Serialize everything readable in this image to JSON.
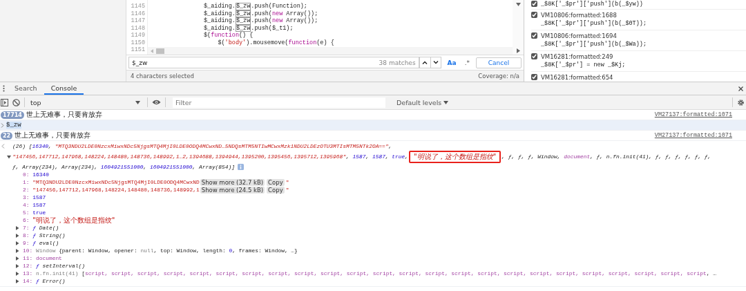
{
  "editor": {
    "line_numbers": [
      "1145",
      "1146",
      "1147",
      "1148",
      "1149",
      "1150",
      "1151"
    ],
    "lines": [
      [
        {
          "text": "$_aiding.",
          "kind": "plain"
        },
        {
          "text": "$_zw",
          "kind": "match"
        },
        {
          "text": ".push(Function);",
          "kind": "plain"
        }
      ],
      [
        {
          "text": "$_aiding.",
          "kind": "plain"
        },
        {
          "text": "$_zw",
          "kind": "match"
        },
        {
          "text": ".push(",
          "kind": "plain"
        },
        {
          "text": "new",
          "kind": "keyword"
        },
        {
          "text": " Array());",
          "kind": "plain"
        }
      ],
      [
        {
          "text": "$_aiding.",
          "kind": "plain"
        },
        {
          "text": "$_zw",
          "kind": "match"
        },
        {
          "text": ".push(",
          "kind": "plain"
        },
        {
          "text": "new",
          "kind": "keyword"
        },
        {
          "text": " Array());",
          "kind": "plain"
        }
      ],
      [
        {
          "text": "$_aiding.",
          "kind": "plain"
        },
        {
          "text": "$_zw",
          "kind": "match"
        },
        {
          "text": ".push($_t1);",
          "kind": "plain"
        }
      ],
      [
        {
          "text": "$(",
          "kind": "plain"
        },
        {
          "text": "function",
          "kind": "keyword"
        },
        {
          "text": "() {",
          "kind": "plain"
        }
      ],
      [
        {
          "text": "    $(",
          "kind": "plain"
        },
        {
          "text": "'body'",
          "kind": "string"
        },
        {
          "text": ").mousemove(",
          "kind": "plain"
        },
        {
          "text": "function",
          "kind": "keyword"
        },
        {
          "text": "(e) {",
          "kind": "plain"
        }
      ]
    ],
    "search": {
      "value": "$_zw",
      "matches": "38 matches",
      "case_label": "Aa",
      "regex_label": ".*",
      "cancel": "Cancel"
    },
    "status": {
      "selection": "4 characters selected",
      "coverage": "Coverage: n/a"
    }
  },
  "breakpoints": [
    {
      "code": "_$8K['_$pr']['push'](b(_$yw))",
      "checked": true
    },
    {
      "label": "VM10806:formatted:1688",
      "code": "_$8K['_$pr']['push'](b(_$0T));",
      "checked": true
    },
    {
      "label": "VM10806:formatted:1694",
      "code": "_$8K['_$pr']['push'](b(_$Wa));",
      "checked": true
    },
    {
      "label": "VM16281:formatted:249",
      "code": "_$8K['_$pr'] = new _$Kj;",
      "checked": true
    },
    {
      "label": "VM16281:formatted:654",
      "checked": true
    }
  ],
  "console": {
    "tabs": [
      {
        "label": "Search",
        "selected": false
      },
      {
        "label": "Console",
        "selected": true
      }
    ],
    "toolbar": {
      "context": "top",
      "filter_placeholder": "Filter",
      "levels": "Default levels"
    },
    "messages": [
      {
        "kind": "log",
        "count": "17714",
        "text": "世上无难事，只要肯放弃",
        "source": "VM27137:formatted:1071"
      },
      {
        "kind": "input",
        "text": "$_zw"
      },
      {
        "kind": "log",
        "count": "22",
        "text": "世上无难事，只要肯放弃",
        "source": "VM27137:formatted:1071"
      },
      {
        "kind": "result",
        "expanded": true,
        "summary": [
          [
            {
              "text": "(26) [",
              "kind": "plain"
            },
            {
              "text": "16340",
              "kind": "num"
            },
            {
              "text": ", ",
              "kind": "plain"
            },
            {
              "text": "\"MTQ3NDU2LDE0NzcxMiwxNDc5NjgsMTQ4MjI0LDE0ODQ4MCwxND…5NDQsMTM5NTIwMCwxMzk1NDU2LDEzOTU3MTIsMTM5NTk2OA==\"",
              "kind": "str"
            },
            {
              "text": ",",
              "kind": "plain"
            }
          ],
          [
            {
              "text": "\"147456,147712,147968,148224,148480,148736,148992,1…2,1394688,1394944,1395200,1395456,1395712,1395968\"",
              "kind": "str"
            },
            {
              "text": ", ",
              "kind": "plain"
            },
            {
              "text": "1587",
              "kind": "num"
            },
            {
              "text": ", ",
              "kind": "plain"
            },
            {
              "text": "1587",
              "kind": "num"
            },
            {
              "text": ", ",
              "kind": "plain"
            },
            {
              "text": "true",
              "kind": "num"
            },
            {
              "text": ",",
              "kind": "plain"
            },
            {
              "text": "\"明说了，这个数组是指纹\"",
              "kind": "cjk-str",
              "boxed": true
            },
            {
              "text": ", ƒ, ƒ, ƒ, Window, ",
              "kind": "plain"
            },
            {
              "text": "document",
              "kind": "obj"
            },
            {
              "text": ", ƒ, n.fn.init(41), ƒ, ƒ, ƒ, ƒ, ƒ, ƒ,",
              "kind": "plain"
            }
          ],
          [
            {
              "text": "ƒ, Array(234), Array(234), ",
              "kind": "plain"
            },
            {
              "text": "1604921551000",
              "kind": "num"
            },
            {
              "text": ", ",
              "kind": "plain"
            },
            {
              "text": "1604921551000",
              "kind": "num"
            },
            {
              "text": ", Array(854)]",
              "kind": "plain"
            }
          ]
        ],
        "entries": [
          {
            "key": "0:",
            "expandable": false,
            "value": [
              {
                "text": "16340",
                "kind": "num"
              }
            ]
          },
          {
            "key": "1:",
            "expandable": false,
            "value": [
              {
                "text": "\"MTQ3NDU2LDE0NzcxMiwxNDc5NjgsMTQ4MjI0LDE0ODQ4MCwxND",
                "kind": "str"
              },
              {
                "text": "Show more (32.7 kB)",
                "kind": "show_more"
              },
              {
                "text": "Copy",
                "kind": "copy"
              },
              {
                "text": "\"",
                "kind": "str"
              }
            ]
          },
          {
            "key": "2:",
            "expandable": false,
            "value": [
              {
                "text": "\"147456,147712,147968,148224,148480,148736,148992,1",
                "kind": "str"
              },
              {
                "text": "Show more (24.5 kB)",
                "kind": "show_more"
              },
              {
                "text": "Copy",
                "kind": "copy"
              },
              {
                "text": "\"",
                "kind": "str"
              }
            ]
          },
          {
            "key": "3:",
            "expandable": false,
            "value": [
              {
                "text": "1587",
                "kind": "num"
              }
            ]
          },
          {
            "key": "4:",
            "expandable": false,
            "value": [
              {
                "text": "1587",
                "kind": "num"
              }
            ]
          },
          {
            "key": "5:",
            "expandable": false,
            "value": [
              {
                "text": "true",
                "kind": "num"
              }
            ]
          },
          {
            "key": "6:",
            "expandable": false,
            "value": [
              {
                "text": "\"明说了，这个数组是指纹\"",
                "kind": "cjk-str"
              }
            ]
          },
          {
            "key": "7:",
            "expandable": true,
            "value": [
              {
                "text": "ƒ",
                "kind": "fn"
              },
              {
                "text": " Date()",
                "kind": "italic"
              }
            ]
          },
          {
            "key": "8:",
            "expandable": true,
            "value": [
              {
                "text": "ƒ",
                "kind": "fn"
              },
              {
                "text": " String()",
                "kind": "italic"
              }
            ]
          },
          {
            "key": "9:",
            "expandable": true,
            "value": [
              {
                "text": "ƒ",
                "kind": "fn"
              },
              {
                "text": " eval()",
                "kind": "italic"
              }
            ]
          },
          {
            "key": "10:",
            "expandable": true,
            "value": [
              {
                "text": "Window ",
                "kind": "dim"
              },
              {
                "text": "{parent: Window, opener: ",
                "kind": "plain"
              },
              {
                "text": "null",
                "kind": "dim"
              },
              {
                "text": ", top: Window, length: ",
                "kind": "plain"
              },
              {
                "text": "0",
                "kind": "num"
              },
              {
                "text": ", frames: Window, …}",
                "kind": "plain"
              }
            ]
          },
          {
            "key": "11:",
            "expandable": true,
            "value": [
              {
                "text": "document",
                "kind": "obj"
              }
            ]
          },
          {
            "key": "12:",
            "expandable": true,
            "value": [
              {
                "text": "ƒ",
                "kind": "fn"
              },
              {
                "text": " setInterval()",
                "kind": "italic"
              }
            ]
          },
          {
            "key": "13:",
            "expandable": true,
            "value": [
              {
                "text": "n.fn.init(41) ",
                "kind": "dim"
              },
              {
                "text": "[",
                "kind": "plain"
              },
              {
                "text": "script, script, script, script, script, script, script, script, script, script, script, script, script, script, script, script, script, script, script, script, script, script, script, script",
                "kind": "obj"
              },
              {
                "text": ", …",
                "kind": "plain"
              }
            ]
          },
          {
            "key": "14:",
            "expandable": true,
            "value": [
              {
                "text": "ƒ",
                "kind": "fn"
              },
              {
                "text": " Error()",
                "kind": "italic"
              }
            ]
          }
        ]
      }
    ]
  }
}
